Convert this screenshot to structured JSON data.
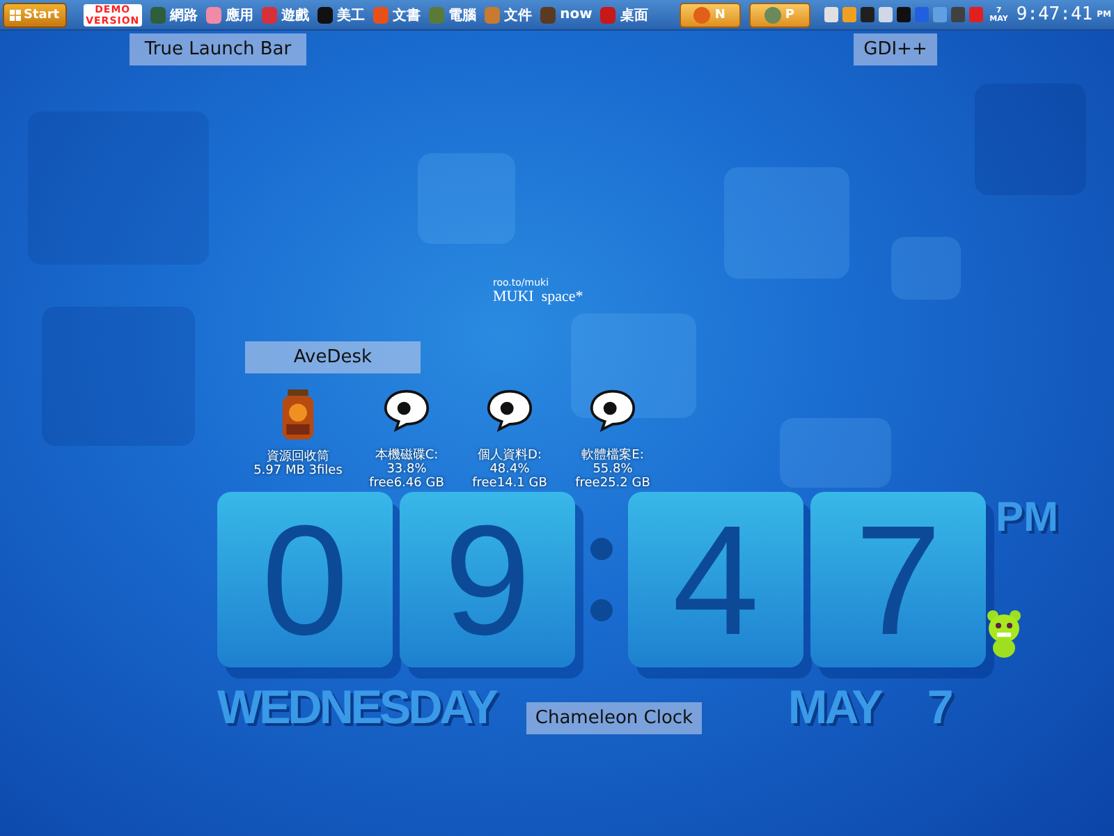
{
  "taskbar": {
    "start": "Start",
    "demo": [
      "DEMO",
      "VERSION"
    ],
    "launch_items": [
      {
        "label": "網路",
        "color": "#2e5e3a"
      },
      {
        "label": "應用",
        "color": "#f08aa8"
      },
      {
        "label": "遊戲",
        "color": "#d8303a"
      },
      {
        "label": "美工",
        "color": "#111111"
      },
      {
        "label": "文書",
        "color": "#e8501a"
      },
      {
        "label": "電腦",
        "color": "#5a7a3a"
      },
      {
        "label": "文件",
        "color": "#c87a30"
      },
      {
        "label": "now",
        "color": "#5a3a20"
      },
      {
        "label": "桌面",
        "color": "#c81818"
      }
    ],
    "task_buttons": [
      {
        "label": "N",
        "color": "#e06018"
      },
      {
        "label": "P",
        "color": "#6a8a5a"
      }
    ],
    "tray_icons": [
      {
        "color": "#e0e0e0"
      },
      {
        "color": "#f0a020"
      },
      {
        "color": "#202020"
      },
      {
        "color": "#d0d8e8"
      },
      {
        "color": "#101010"
      },
      {
        "color": "#2060e0"
      },
      {
        "color": "#60a0e0"
      },
      {
        "color": "#404040"
      },
      {
        "color": "#e02020"
      }
    ],
    "date_day": "7",
    "date_month": "MAY",
    "time": "9:47:41",
    "ampm": "PM"
  },
  "labels": [
    {
      "text": "True Launch Bar"
    },
    {
      "text": "GDI++"
    },
    {
      "text": "AveDesk"
    },
    {
      "text": "Chameleon Clock"
    }
  ],
  "signature": {
    "url": "roo.to/muki",
    "name": "MUKI  space*"
  },
  "recycle_bin": {
    "name": "資源回收筒",
    "info": "5.97 MB 3files"
  },
  "drives": [
    {
      "name": "本機磁碟C:",
      "used": "33.8%",
      "free": "free6.46 GB"
    },
    {
      "name": "個人資料D:",
      "used": "48.4%",
      "free": "free14.1 GB"
    },
    {
      "name": "軟體檔案E:",
      "used": "55.8%",
      "free": "free25.2 GB"
    }
  ],
  "clock": {
    "digits": [
      "0",
      "9",
      "4",
      "7"
    ],
    "ampm": "PM",
    "weekday": "WEDNESDAY",
    "month": "MAY",
    "day": "7"
  }
}
